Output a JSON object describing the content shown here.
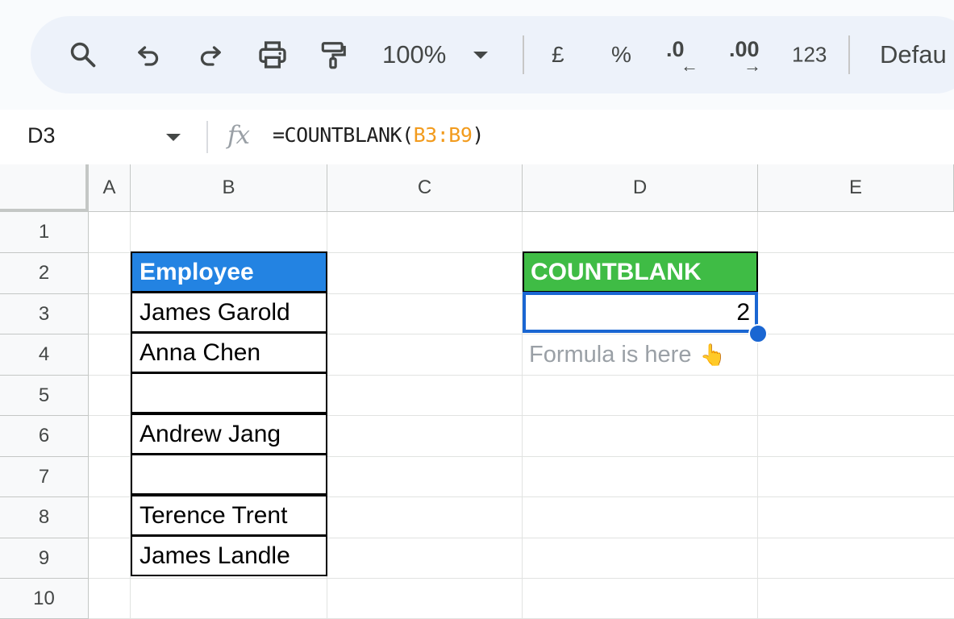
{
  "toolbar": {
    "zoom": "100%",
    "currency_label": "£",
    "percent_label": "%",
    "decrease_decimal_label": ".0",
    "increase_decimal_label": ".00",
    "number_format_label": "123",
    "font_label": "Defau",
    "icons": [
      "search-icon",
      "undo-icon",
      "redo-icon",
      "print-icon",
      "paint-format-icon",
      "chevron-down-icon"
    ]
  },
  "formula_bar": {
    "name_box": "D3",
    "fx_label": "fx",
    "formula_prefix": "=COUNTBLANK(",
    "formula_ref": "B3:B9",
    "formula_suffix": ")"
  },
  "columns": [
    "A",
    "B",
    "C",
    "D",
    "E"
  ],
  "rows": [
    "1",
    "2",
    "3",
    "4",
    "5",
    "6",
    "7",
    "8",
    "9",
    "10"
  ],
  "cells": {
    "B2": "Employee",
    "B3": "James Garold",
    "B4": "Anna Chen",
    "B5": "",
    "B6": "Andrew Jang",
    "B7": "",
    "B8": "Terence Trent",
    "B9": "James Landle",
    "D2": "COUNTBLANK",
    "D3": "2",
    "D4": "Formula is here",
    "D4_emoji": "👆"
  },
  "colors": {
    "header_blue": "#2383e2",
    "header_green": "#3fbc45",
    "selection_blue": "#1a66d2",
    "range_ref_orange": "#f29b1d"
  }
}
